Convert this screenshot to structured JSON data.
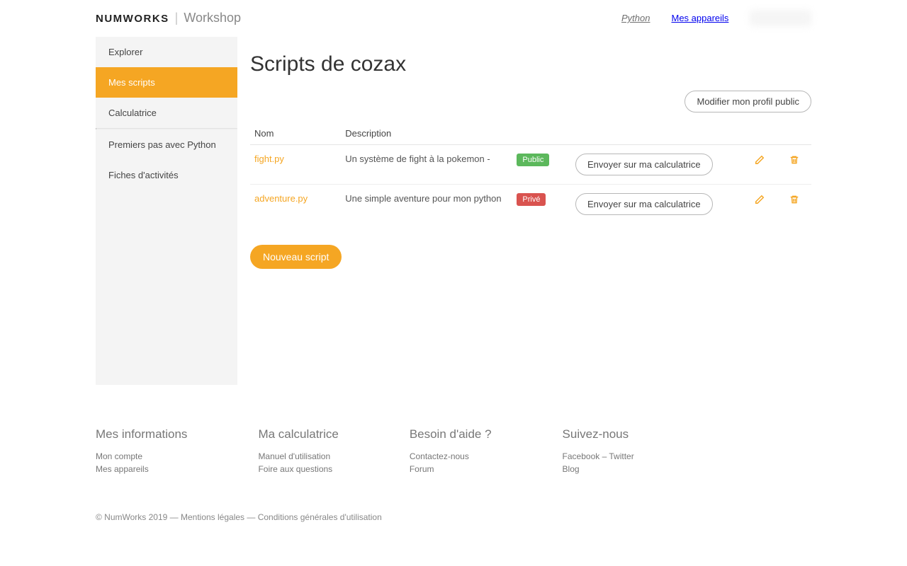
{
  "header": {
    "brand": "NUMWORKS",
    "subbrand": "Workshop",
    "nav": {
      "python": "Python",
      "devices": "Mes appareils"
    }
  },
  "sidebar": {
    "explore": "Explorer",
    "my_scripts": "Mes scripts",
    "calculator": "Calculatrice",
    "first_steps": "Premiers pas avec Python",
    "activities": "Fiches d'activités"
  },
  "main": {
    "title": "Scripts de cozax",
    "edit_profile": "Modifier mon profil public",
    "columns": {
      "name": "Nom",
      "description": "Description"
    },
    "send_label": "Envoyer sur ma calculatrice",
    "new_script": "Nouveau script",
    "scripts": [
      {
        "name": "fight.py",
        "description": "Un système de fight à la pokemon -",
        "visibility": "Public"
      },
      {
        "name": "adventure.py",
        "description": "Une simple aventure pour mon python",
        "visibility": "Privé"
      }
    ]
  },
  "footer": {
    "cols": {
      "info": {
        "title": "Mes informations",
        "account": "Mon compte",
        "devices": "Mes appareils"
      },
      "calc": {
        "title": "Ma calculatrice",
        "manual": "Manuel d'utilisation",
        "faq": "Foire aux questions"
      },
      "help": {
        "title": "Besoin d'aide ?",
        "contact": "Contactez-nous",
        "forum": "Forum"
      },
      "follow": {
        "title": "Suivez-nous",
        "social": "Facebook – Twitter",
        "blog": "Blog"
      }
    },
    "copyright": "© NumWorks 2019 — Mentions légales — Conditions générales d'utilisation"
  }
}
